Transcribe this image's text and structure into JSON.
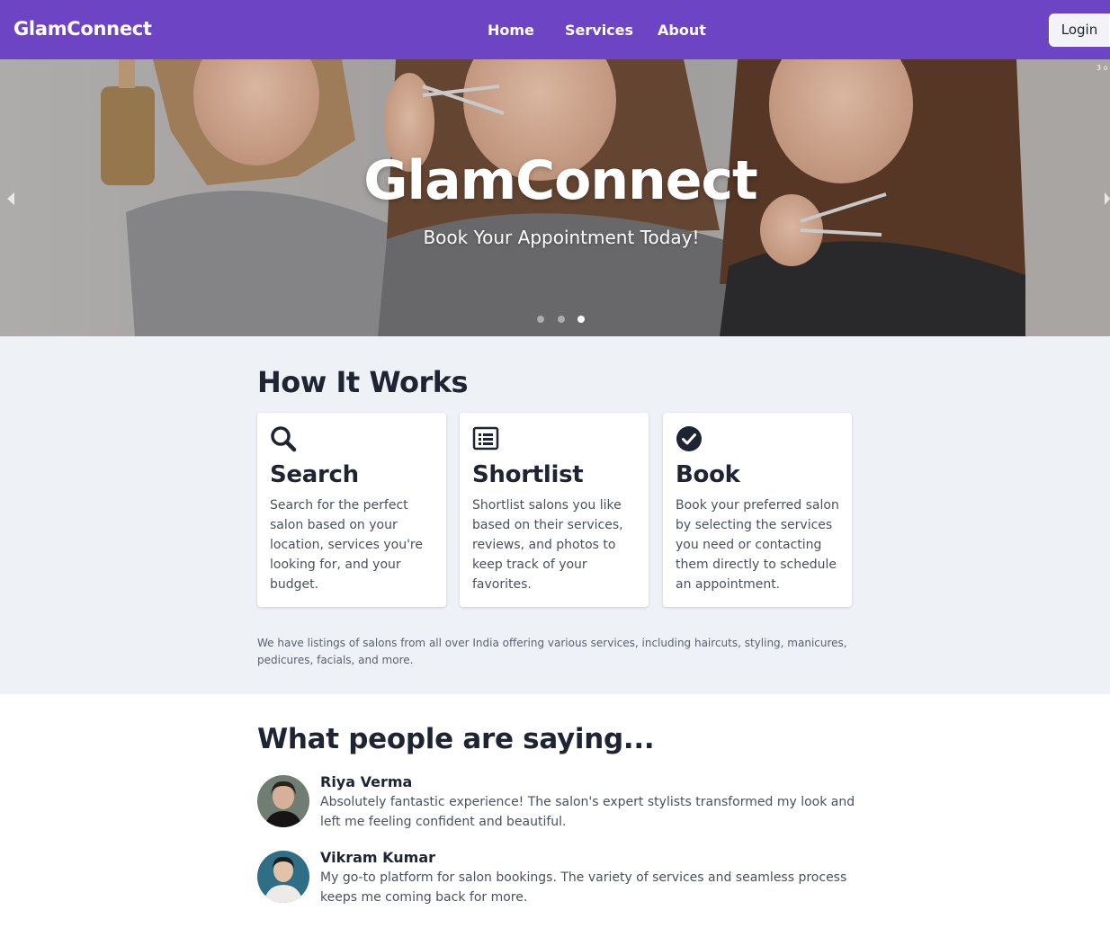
{
  "navbar": {
    "brand": "GlamConnect",
    "links": [
      "Home",
      "Services",
      "About"
    ],
    "login_label": "Login"
  },
  "hero": {
    "title": "GlamConnect",
    "subtitle": "Book Your Appointment Today!",
    "slide_counter": "3 o",
    "slide_count": 3,
    "active_slide": 3
  },
  "how_it_works": {
    "title": "How It Works",
    "cards": [
      {
        "icon": "search-icon",
        "title": "Search",
        "text": "Search for the perfect salon based on your location, services you're looking for, and your budget."
      },
      {
        "icon": "list-icon",
        "title": "Shortlist",
        "text": "Shortlist salons you like based on their services, reviews, and photos to keep track of your favorites."
      },
      {
        "icon": "check-circle-icon",
        "title": "Book",
        "text": "Book your preferred salon by selecting the services you need or contacting them directly to schedule an appointment."
      }
    ],
    "note": "We have listings of salons from all over India offering various services, including haircuts, styling, manicures, pedicures, facials, and more."
  },
  "testimonials": {
    "title": "What people are saying...",
    "items": [
      {
        "name": "Riya Verma",
        "text": "Absolutely fantastic experience! The salon's expert stylists transformed my look and left me feeling confident and beautiful."
      },
      {
        "name": "Vikram Kumar",
        "text": "My go-to platform for salon bookings. The variety of services and seamless process keeps me coming back for more."
      }
    ]
  },
  "colors": {
    "navbar": "#6c44c4",
    "section_bg": "#eef2f6",
    "text_dark": "#1f2433",
    "text_muted": "#4a5060"
  }
}
